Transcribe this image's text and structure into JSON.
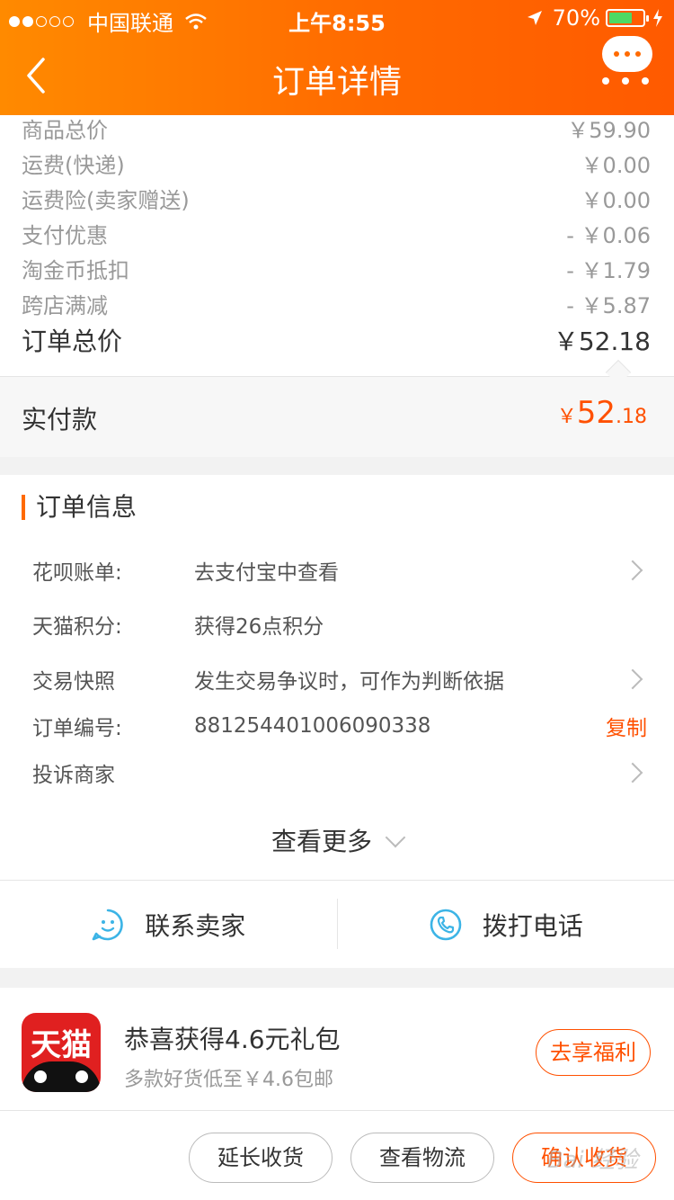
{
  "status_bar": {
    "carrier": "中国联通",
    "time": "上午8:55",
    "battery": "70%",
    "battery_level": 0.7
  },
  "nav": {
    "title": "订单详情"
  },
  "price_rows": [
    {
      "label": "商品总价",
      "value": "￥59.90"
    },
    {
      "label": "运费(快递)",
      "value": "￥0.00"
    },
    {
      "label": "运费险(卖家赠送)",
      "value": "￥0.00"
    },
    {
      "label": "支付优惠",
      "value": "- ￥0.06"
    },
    {
      "label": "淘金币抵扣",
      "value": "- ￥1.79"
    },
    {
      "label": "跨店满减",
      "value": "- ￥5.87"
    }
  ],
  "order_total": {
    "label": "订单总价",
    "value": "￥52.18"
  },
  "paid": {
    "label": "实付款",
    "currency": "￥",
    "int": "52",
    "dec": ".18"
  },
  "order_info": {
    "title": "订单信息",
    "rows": [
      {
        "label": "花呗账单:",
        "value": "去支付宝中查看"
      },
      {
        "label": "天猫积分:",
        "value": "获得26点积分"
      },
      {
        "label": "交易快照",
        "value": "发生交易争议时，可作为判断依据"
      },
      {
        "label": "订单编号:",
        "value": "881254401006090338",
        "action": "复制"
      },
      {
        "label": "投诉商家",
        "value": ""
      }
    ],
    "see_more": "查看更多"
  },
  "contact": {
    "seller": "联系卖家",
    "phone": "拨打电话"
  },
  "promo": {
    "logo_text": "天猫",
    "title": "恭喜获得4.6元礼包",
    "subtitle": "多款好货低至￥4.6包邮",
    "button": "去享福利"
  },
  "actions": {
    "extend": "延长收货",
    "logistics": "查看物流",
    "confirm": "确认收货"
  },
  "watermark": "Bai 经验",
  "colors": {
    "header_start": "#ff8a00",
    "header_end": "#ff5a00",
    "accent": "#ff5000",
    "contact_icon": "#3cb4e6"
  }
}
